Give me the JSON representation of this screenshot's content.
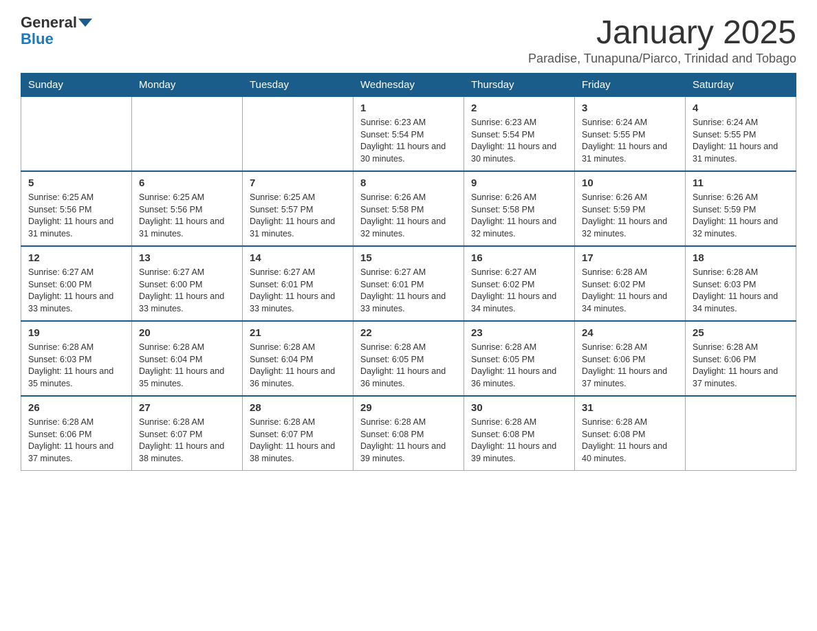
{
  "header": {
    "logo_text": "General",
    "logo_blue": "Blue",
    "title": "January 2025",
    "subtitle": "Paradise, Tunapuna/Piarco, Trinidad and Tobago"
  },
  "days_of_week": [
    "Sunday",
    "Monday",
    "Tuesday",
    "Wednesday",
    "Thursday",
    "Friday",
    "Saturday"
  ],
  "weeks": [
    [
      {
        "day": "",
        "info": ""
      },
      {
        "day": "",
        "info": ""
      },
      {
        "day": "",
        "info": ""
      },
      {
        "day": "1",
        "info": "Sunrise: 6:23 AM\nSunset: 5:54 PM\nDaylight: 11 hours and 30 minutes."
      },
      {
        "day": "2",
        "info": "Sunrise: 6:23 AM\nSunset: 5:54 PM\nDaylight: 11 hours and 30 minutes."
      },
      {
        "day": "3",
        "info": "Sunrise: 6:24 AM\nSunset: 5:55 PM\nDaylight: 11 hours and 31 minutes."
      },
      {
        "day": "4",
        "info": "Sunrise: 6:24 AM\nSunset: 5:55 PM\nDaylight: 11 hours and 31 minutes."
      }
    ],
    [
      {
        "day": "5",
        "info": "Sunrise: 6:25 AM\nSunset: 5:56 PM\nDaylight: 11 hours and 31 minutes."
      },
      {
        "day": "6",
        "info": "Sunrise: 6:25 AM\nSunset: 5:56 PM\nDaylight: 11 hours and 31 minutes."
      },
      {
        "day": "7",
        "info": "Sunrise: 6:25 AM\nSunset: 5:57 PM\nDaylight: 11 hours and 31 minutes."
      },
      {
        "day": "8",
        "info": "Sunrise: 6:26 AM\nSunset: 5:58 PM\nDaylight: 11 hours and 32 minutes."
      },
      {
        "day": "9",
        "info": "Sunrise: 6:26 AM\nSunset: 5:58 PM\nDaylight: 11 hours and 32 minutes."
      },
      {
        "day": "10",
        "info": "Sunrise: 6:26 AM\nSunset: 5:59 PM\nDaylight: 11 hours and 32 minutes."
      },
      {
        "day": "11",
        "info": "Sunrise: 6:26 AM\nSunset: 5:59 PM\nDaylight: 11 hours and 32 minutes."
      }
    ],
    [
      {
        "day": "12",
        "info": "Sunrise: 6:27 AM\nSunset: 6:00 PM\nDaylight: 11 hours and 33 minutes."
      },
      {
        "day": "13",
        "info": "Sunrise: 6:27 AM\nSunset: 6:00 PM\nDaylight: 11 hours and 33 minutes."
      },
      {
        "day": "14",
        "info": "Sunrise: 6:27 AM\nSunset: 6:01 PM\nDaylight: 11 hours and 33 minutes."
      },
      {
        "day": "15",
        "info": "Sunrise: 6:27 AM\nSunset: 6:01 PM\nDaylight: 11 hours and 33 minutes."
      },
      {
        "day": "16",
        "info": "Sunrise: 6:27 AM\nSunset: 6:02 PM\nDaylight: 11 hours and 34 minutes."
      },
      {
        "day": "17",
        "info": "Sunrise: 6:28 AM\nSunset: 6:02 PM\nDaylight: 11 hours and 34 minutes."
      },
      {
        "day": "18",
        "info": "Sunrise: 6:28 AM\nSunset: 6:03 PM\nDaylight: 11 hours and 34 minutes."
      }
    ],
    [
      {
        "day": "19",
        "info": "Sunrise: 6:28 AM\nSunset: 6:03 PM\nDaylight: 11 hours and 35 minutes."
      },
      {
        "day": "20",
        "info": "Sunrise: 6:28 AM\nSunset: 6:04 PM\nDaylight: 11 hours and 35 minutes."
      },
      {
        "day": "21",
        "info": "Sunrise: 6:28 AM\nSunset: 6:04 PM\nDaylight: 11 hours and 36 minutes."
      },
      {
        "day": "22",
        "info": "Sunrise: 6:28 AM\nSunset: 6:05 PM\nDaylight: 11 hours and 36 minutes."
      },
      {
        "day": "23",
        "info": "Sunrise: 6:28 AM\nSunset: 6:05 PM\nDaylight: 11 hours and 36 minutes."
      },
      {
        "day": "24",
        "info": "Sunrise: 6:28 AM\nSunset: 6:06 PM\nDaylight: 11 hours and 37 minutes."
      },
      {
        "day": "25",
        "info": "Sunrise: 6:28 AM\nSunset: 6:06 PM\nDaylight: 11 hours and 37 minutes."
      }
    ],
    [
      {
        "day": "26",
        "info": "Sunrise: 6:28 AM\nSunset: 6:06 PM\nDaylight: 11 hours and 37 minutes."
      },
      {
        "day": "27",
        "info": "Sunrise: 6:28 AM\nSunset: 6:07 PM\nDaylight: 11 hours and 38 minutes."
      },
      {
        "day": "28",
        "info": "Sunrise: 6:28 AM\nSunset: 6:07 PM\nDaylight: 11 hours and 38 minutes."
      },
      {
        "day": "29",
        "info": "Sunrise: 6:28 AM\nSunset: 6:08 PM\nDaylight: 11 hours and 39 minutes."
      },
      {
        "day": "30",
        "info": "Sunrise: 6:28 AM\nSunset: 6:08 PM\nDaylight: 11 hours and 39 minutes."
      },
      {
        "day": "31",
        "info": "Sunrise: 6:28 AM\nSunset: 6:08 PM\nDaylight: 11 hours and 40 minutes."
      },
      {
        "day": "",
        "info": ""
      }
    ]
  ]
}
